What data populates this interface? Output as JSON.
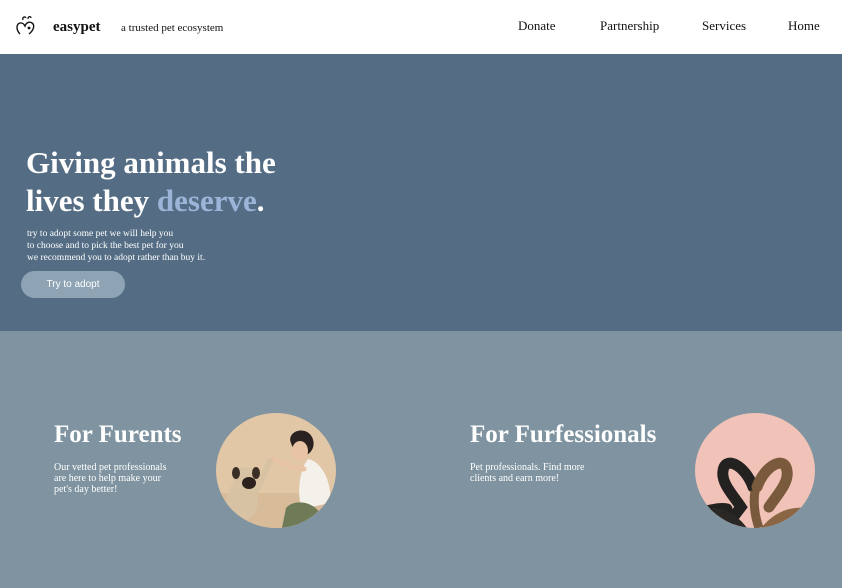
{
  "header": {
    "brand": "easypet",
    "tagline": "a trusted pet ecosystem",
    "logo_icon": "paw-heart-icon",
    "nav": [
      "Donate",
      "Partnership",
      "Services",
      "Home"
    ]
  },
  "hero": {
    "title_line1": "Giving animals the",
    "title_line2_prefix": "lives they ",
    "title_accent": "deserve",
    "title_suffix": ".",
    "description": [
      "try to adopt some pet we will help you",
      "to choose and to pick the best pet for you",
      "we recommend you to adopt rather than buy it."
    ],
    "cta_label": "Try to adopt"
  },
  "features": [
    {
      "title": "For Furents",
      "description": [
        "Our vetted pet professionals",
        "are here to help make your",
        "pet's day better!"
      ],
      "image": "woman-high-five-pug-photo"
    },
    {
      "title": "For Furfessionals",
      "description": [
        "Pet professionals. Find more",
        "clients and earn more!"
      ],
      "image": "cat-tails-heart-photo"
    }
  ],
  "colors": {
    "hero_bg": "#546d84",
    "features_bg": "#7f94a0",
    "accent": "#9bb4d8",
    "button_bg": "#8ea3b3"
  }
}
